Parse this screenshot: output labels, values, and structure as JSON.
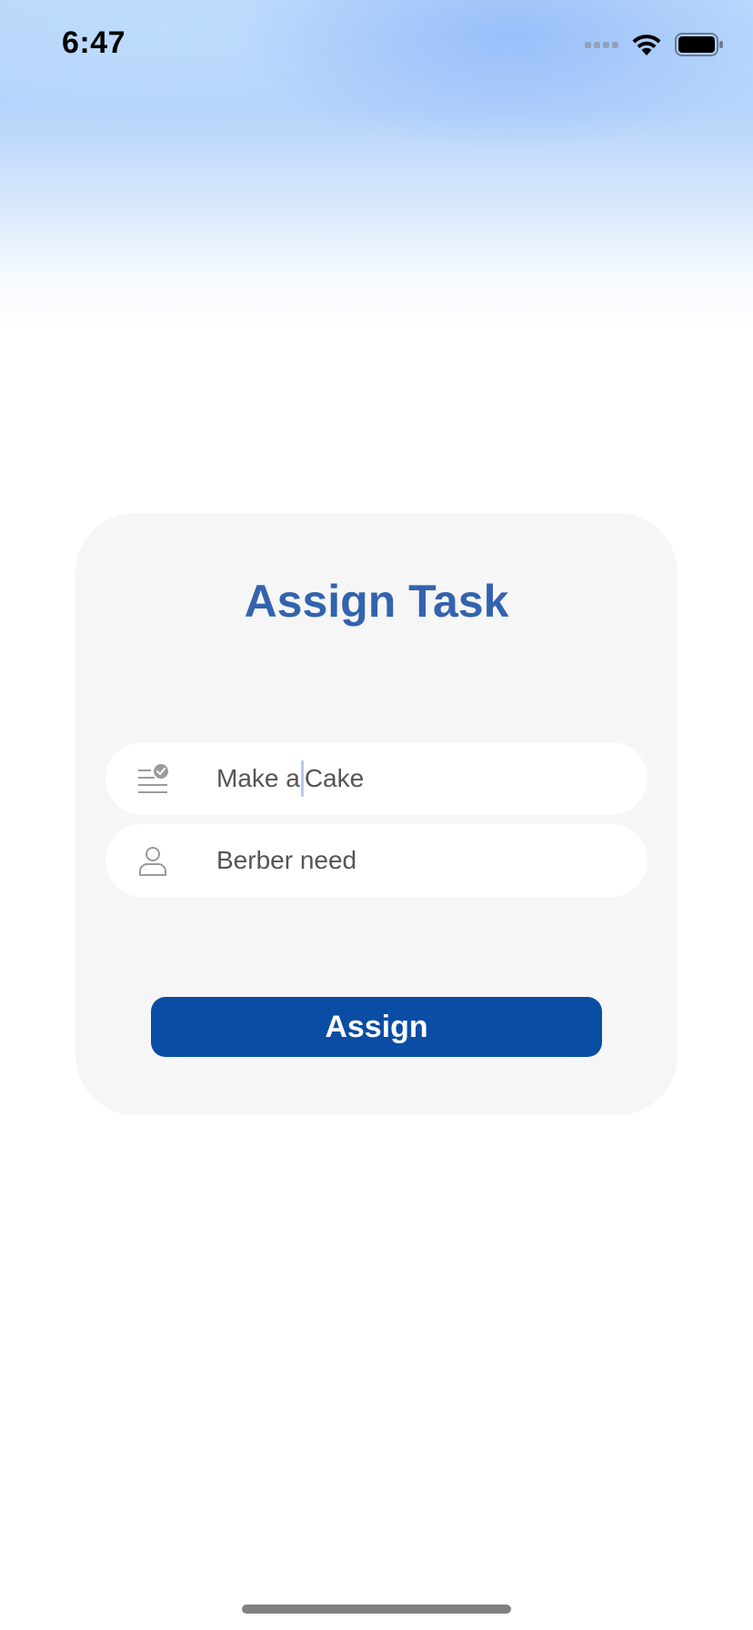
{
  "status_bar": {
    "time": "6:47",
    "icons": [
      "signal-icon",
      "wifi-icon",
      "battery-icon"
    ]
  },
  "card": {
    "title": "Assign Task",
    "task_field": {
      "icon": "task-list-check-icon",
      "value_before_cursor": "Make a",
      "value_after_cursor": "Cake"
    },
    "person_field": {
      "icon": "person-icon",
      "value": "Berber need"
    },
    "assign_button_label": "Assign"
  },
  "colors": {
    "title": "#3363ae",
    "button": "#0a4da5",
    "card_background": "#f6f6f6"
  }
}
